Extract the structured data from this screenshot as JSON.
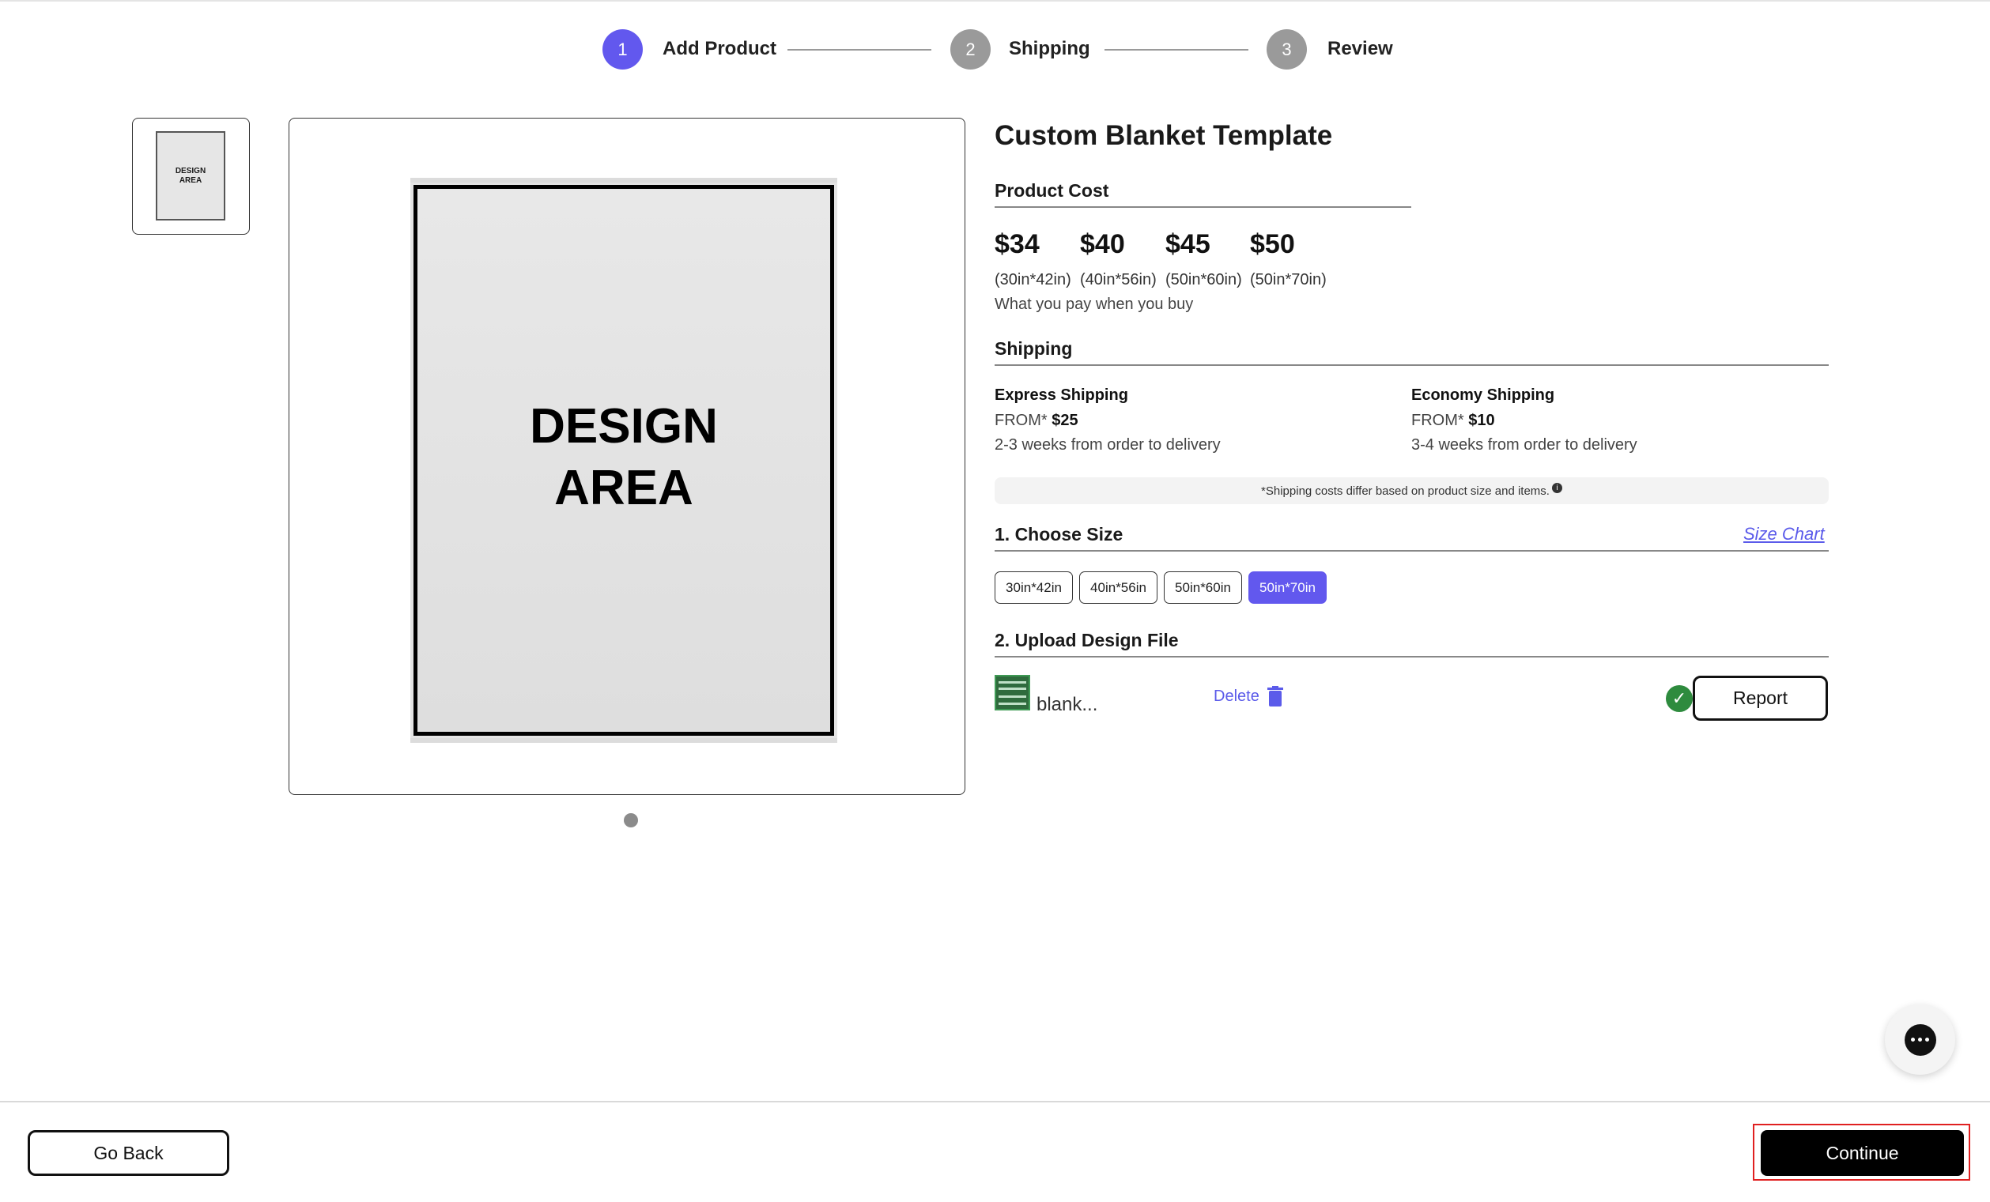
{
  "stepper": {
    "steps": [
      {
        "number": "1",
        "label": "Add Product",
        "color": "#6258ee"
      },
      {
        "number": "2",
        "label": "Shipping",
        "color": "#9a9a9a"
      },
      {
        "number": "3",
        "label": "Review",
        "color": "#9a9a9a"
      }
    ]
  },
  "gallery": {
    "thumb_text_1": "DESIGN",
    "thumb_text_2": "AREA",
    "main_text_1": "DESIGN",
    "main_text_2": "AREA"
  },
  "product": {
    "title": "Custom Blanket Template",
    "cost_heading": "Product Cost",
    "prices": [
      {
        "price": "$34",
        "size": "(30in*42in)"
      },
      {
        "price": "$40",
        "size": "(40in*56in)"
      },
      {
        "price": "$45",
        "size": "(50in*60in)"
      },
      {
        "price": "$50",
        "size": "(50in*70in)"
      }
    ],
    "price_note": "What you pay when you buy"
  },
  "shipping": {
    "heading": "Shipping",
    "options": [
      {
        "title": "Express Shipping",
        "from_label": "FROM*",
        "price": "$25",
        "eta": "2-3 weeks from order to delivery"
      },
      {
        "title": "Economy Shipping",
        "from_label": "FROM*",
        "price": "$10",
        "eta": "3-4 weeks from order to delivery"
      }
    ],
    "note": "*Shipping costs differ based on product size and items."
  },
  "choose_size": {
    "heading": "1. Choose Size",
    "size_chart_link": "Size Chart",
    "options": [
      "30in*42in",
      "40in*56in",
      "50in*60in",
      "50in*70in"
    ],
    "selected": "50in*70in",
    "accent": "#6258ee"
  },
  "upload": {
    "heading": "2. Upload Design File",
    "file_name": "blank...",
    "delete_label": "Delete",
    "report_label": "Report",
    "status": "check-icon"
  },
  "footer": {
    "back_label": "Go Back",
    "continue_label": "Continue"
  }
}
